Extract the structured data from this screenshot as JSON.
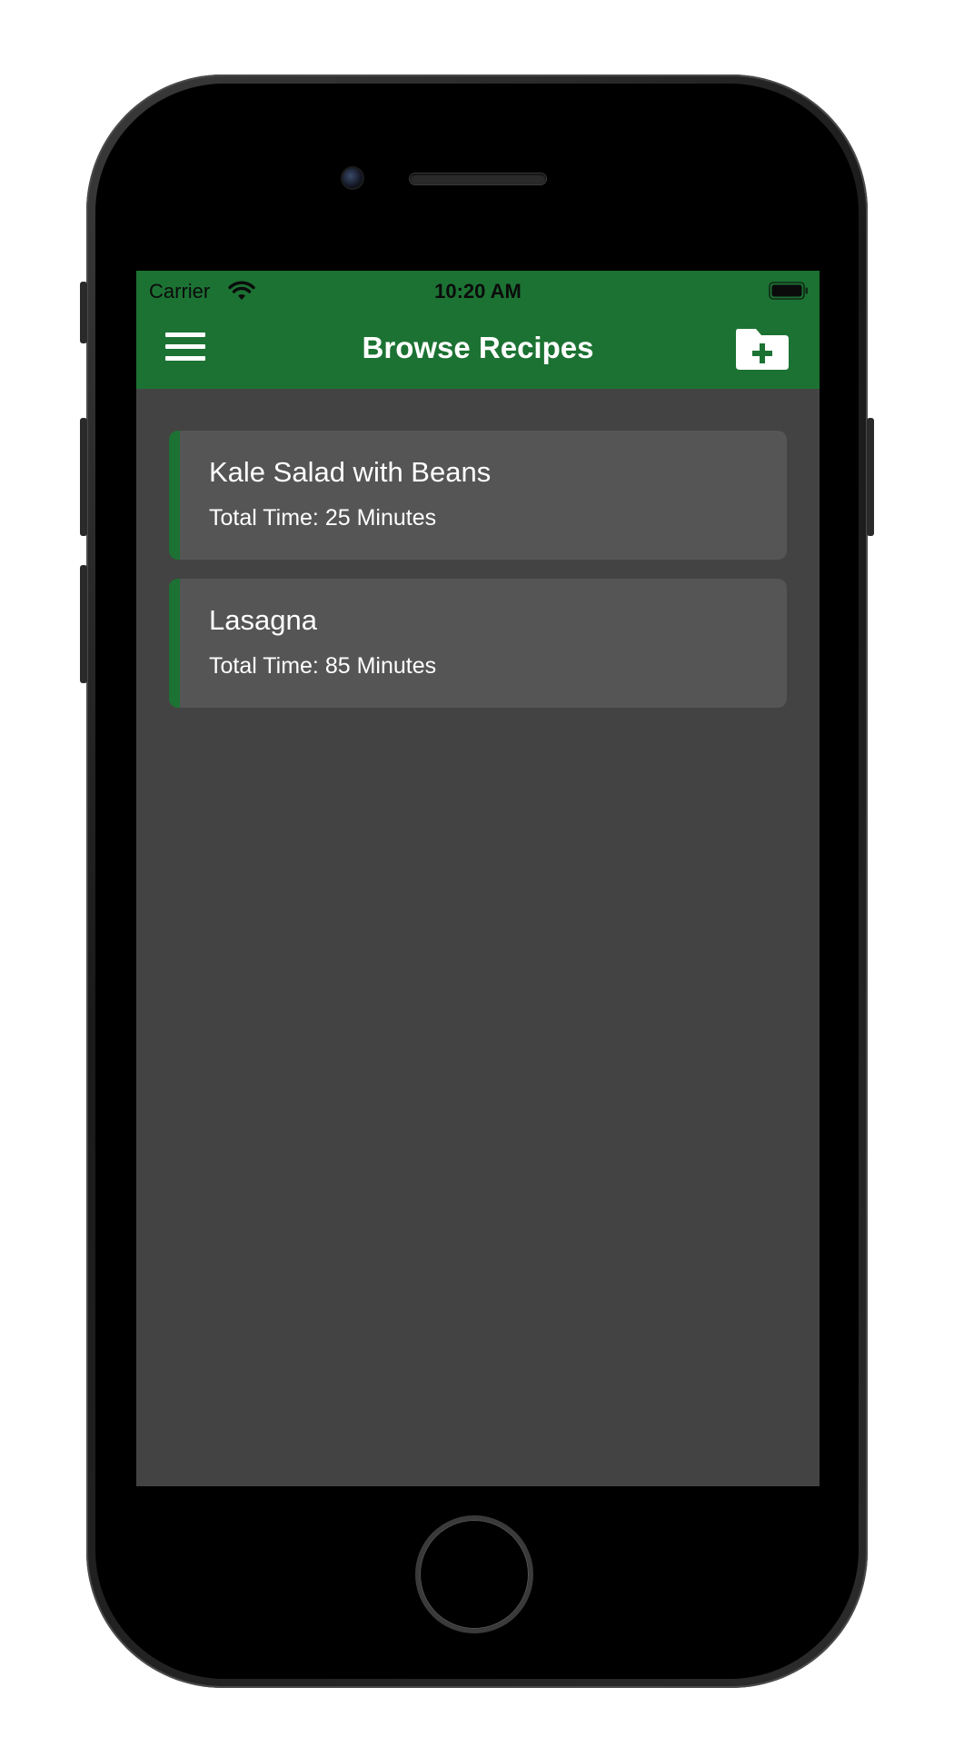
{
  "status_bar": {
    "carrier": "Carrier",
    "time": "10:20 AM",
    "wifi_icon": "wifi-icon",
    "battery_icon": "battery-full-icon"
  },
  "nav": {
    "title": "Browse Recipes",
    "menu_icon": "hamburger-menu-icon",
    "add_icon": "folder-plus-icon"
  },
  "recipes": [
    {
      "name": "Kale Salad with Beans",
      "total_time": "Total Time: 25 Minutes"
    },
    {
      "name": "Lasagna",
      "total_time": "Total Time: 85 Minutes"
    }
  ],
  "colors": {
    "brand_green": "#1c7233",
    "screen_background": "#434343",
    "card_background": "#555555",
    "text": "#ffffff"
  }
}
